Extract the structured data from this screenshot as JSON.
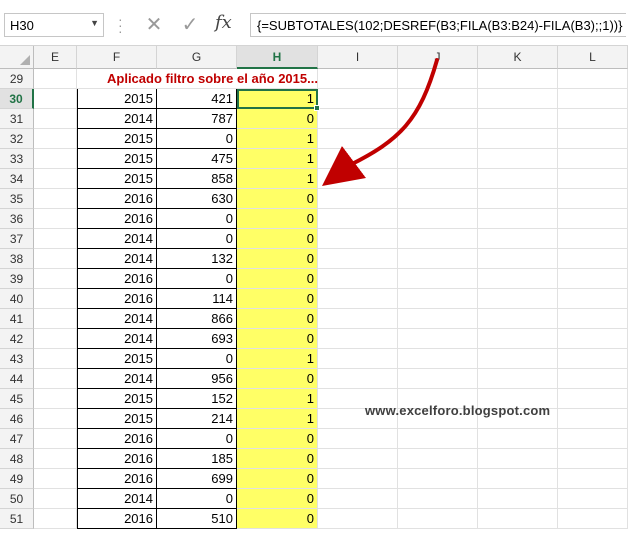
{
  "formula_bar": {
    "name_box": "H30",
    "cancel_icon": "✕",
    "enter_icon": "✓",
    "fx_label": "fx",
    "formula": "{=SUBTOTALES(102;DESREF(B3;FILA(B3:B24)-FILA(B3);;1))}"
  },
  "columns": [
    "E",
    "F",
    "G",
    "H",
    "I",
    "J",
    "K",
    "L"
  ],
  "active_column": "H",
  "active_row": "30",
  "title_row": {
    "row": "29",
    "text": "Aplicado filtro sobre el año 2015..."
  },
  "rows": [
    {
      "row": "30",
      "f": "2015",
      "g": "421",
      "h": "1"
    },
    {
      "row": "31",
      "f": "2014",
      "g": "787",
      "h": "0"
    },
    {
      "row": "32",
      "f": "2015",
      "g": "0",
      "h": "1"
    },
    {
      "row": "33",
      "f": "2015",
      "g": "475",
      "h": "1"
    },
    {
      "row": "34",
      "f": "2015",
      "g": "858",
      "h": "1"
    },
    {
      "row": "35",
      "f": "2016",
      "g": "630",
      "h": "0"
    },
    {
      "row": "36",
      "f": "2016",
      "g": "0",
      "h": "0"
    },
    {
      "row": "37",
      "f": "2014",
      "g": "0",
      "h": "0"
    },
    {
      "row": "38",
      "f": "2014",
      "g": "132",
      "h": "0"
    },
    {
      "row": "39",
      "f": "2016",
      "g": "0",
      "h": "0"
    },
    {
      "row": "40",
      "f": "2016",
      "g": "114",
      "h": "0"
    },
    {
      "row": "41",
      "f": "2014",
      "g": "866",
      "h": "0"
    },
    {
      "row": "42",
      "f": "2014",
      "g": "693",
      "h": "0"
    },
    {
      "row": "43",
      "f": "2015",
      "g": "0",
      "h": "1"
    },
    {
      "row": "44",
      "f": "2014",
      "g": "956",
      "h": "0"
    },
    {
      "row": "45",
      "f": "2015",
      "g": "152",
      "h": "1"
    },
    {
      "row": "46",
      "f": "2015",
      "g": "214",
      "h": "1"
    },
    {
      "row": "47",
      "f": "2016",
      "g": "0",
      "h": "0"
    },
    {
      "row": "48",
      "f": "2016",
      "g": "185",
      "h": "0"
    },
    {
      "row": "49",
      "f": "2016",
      "g": "699",
      "h": "0"
    },
    {
      "row": "50",
      "f": "2014",
      "g": "0",
      "h": "0"
    },
    {
      "row": "51",
      "f": "2016",
      "g": "510",
      "h": "0"
    }
  ],
  "watermark": "www.excelforo.blogspot.com",
  "colors": {
    "highlight": "#ffff66",
    "title": "#c00000",
    "selection": "#217346",
    "arrow": "#c00000"
  }
}
